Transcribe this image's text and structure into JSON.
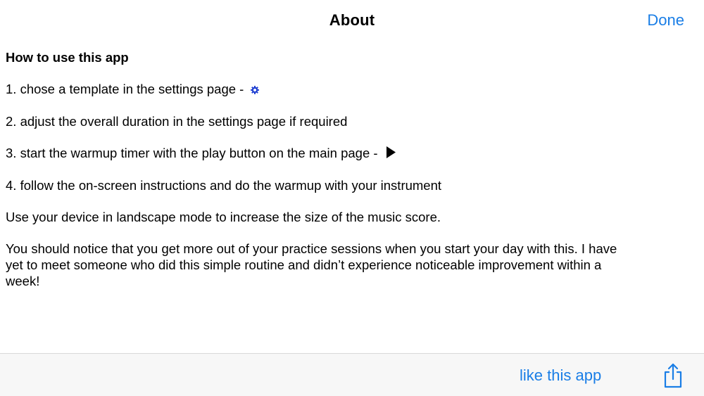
{
  "navbar": {
    "title": "About",
    "done_label": "Done"
  },
  "content": {
    "heading": "How to use this app",
    "steps": [
      "1. chose a template in the settings page -",
      "2. adjust the overall duration in the settings page if required",
      "3. start the warmup timer with the play button on the main page -",
      "4. follow the on-screen instructions and do the warmup with your instrument"
    ],
    "landscape_note": "Use your device in landscape mode to increase the size of the music score.",
    "closing": "You should notice that you get more out of your practice sessions when you start your day with this. I have yet to meet someone who did this simple routine and didn’t experience noticeable improvement within a week!"
  },
  "toolbar": {
    "like_label": "like this app"
  },
  "icons": {
    "settings": "gear-icon",
    "play": "play-icon",
    "share": "share-icon"
  },
  "colors": {
    "accent": "#1a7ee6",
    "gear": "#1f3fd1",
    "toolbar_bg": "#f7f7f7"
  }
}
